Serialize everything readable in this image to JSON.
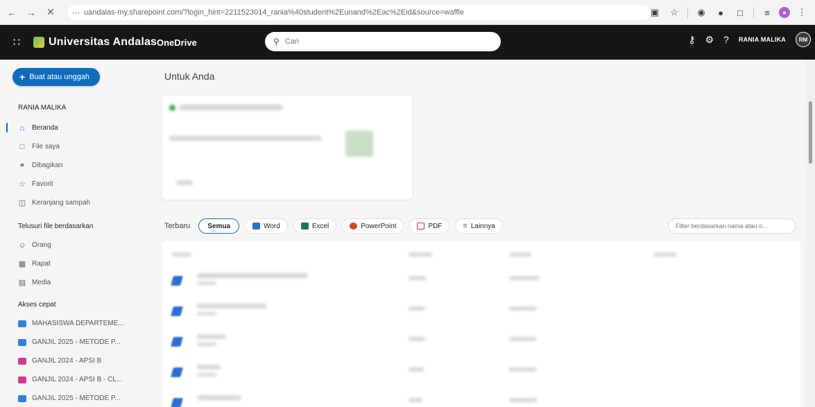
{
  "browser": {
    "url": "uandalas-my.sharepoint.com/?login_hint=2211523014_rania%40student%2Eunand%2Eac%2Eid&source=waffle",
    "back_icon": "arrow-left",
    "forward_icon": "arrow-right",
    "close_icon": "close"
  },
  "header": {
    "org_name": "Universitas Andalas",
    "app_name": "OneDrive",
    "search_placeholder": "Cari",
    "user_name": "RANIA MALIKA",
    "user_initials": "RM"
  },
  "sidebar": {
    "create_label": "Buat atau unggah",
    "user_label": "RANIA MALIKA",
    "nav_items": [
      {
        "label": "Beranda",
        "icon": "home-icon",
        "active": true
      },
      {
        "label": "File saya",
        "icon": "folder-icon",
        "active": false
      },
      {
        "label": "Dibagikan",
        "icon": "people-icon",
        "active": false
      },
      {
        "label": "Favorit",
        "icon": "star-icon",
        "active": false
      },
      {
        "label": "Keranjang sampah",
        "icon": "trash-icon",
        "active": false
      }
    ],
    "browse_title": "Telusuri file berdasarkan",
    "browse_items": [
      {
        "label": "Orang",
        "icon": "person-icon"
      },
      {
        "label": "Rapat",
        "icon": "calendar-icon"
      },
      {
        "label": "Media",
        "icon": "media-icon"
      }
    ],
    "quick_title": "Akses cepat",
    "quick_items": [
      {
        "label": "MAHASISWA DEPARTEME...",
        "color": "blue"
      },
      {
        "label": "GANJIL 2025 - METODE P...",
        "color": "blue"
      },
      {
        "label": "GANJIL 2024 - APSI B",
        "color": "pink"
      },
      {
        "label": "GANJIL 2024 - APSI B - CL...",
        "color": "pink"
      },
      {
        "label": "GANJIL 2025 - METODE P...",
        "color": "blue"
      }
    ]
  },
  "main": {
    "title": "Untuk Anda",
    "recent_label": "Terbaru",
    "filters": [
      {
        "label": "Semua",
        "active": true,
        "icon": ""
      },
      {
        "label": "Word",
        "active": false,
        "icon": "word-icon"
      },
      {
        "label": "Excel",
        "active": false,
        "icon": "excel-icon"
      },
      {
        "label": "PowerPoint",
        "active": false,
        "icon": "powerpoint-icon"
      },
      {
        "label": "PDF",
        "active": false,
        "icon": "pdf-icon"
      },
      {
        "label": "Lainnya",
        "active": false,
        "icon": "filter-icon"
      }
    ],
    "filter_placeholder": "Filter berdasarkan nama atau o..."
  },
  "colors": {
    "accent": "#0f6cbd",
    "header_bg": "#161616",
    "word": "#2b6fd2",
    "excel": "#1e7b45",
    "powerpoint": "#d24726",
    "pdf": "#c8372d",
    "quick_blue": "#2f83d7",
    "quick_pink": "#d6398c"
  }
}
